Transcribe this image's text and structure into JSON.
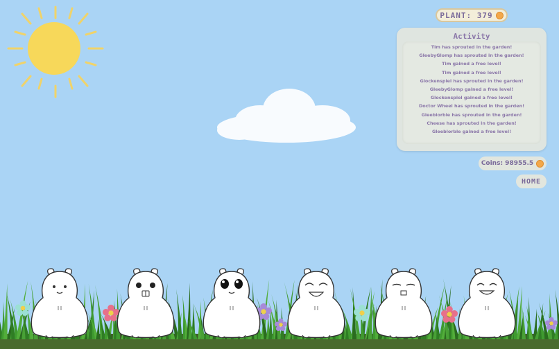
{
  "plant": {
    "label": "PLANT: 379"
  },
  "activity": {
    "title": "Activity",
    "entries": [
      "Tim has sprouted in the garden!",
      "GleebyGlomp has sprouted in the garden!",
      "Tim gained a free level!",
      "Tim gained a free level!",
      "Glockenspiel has sprouted in the garden!",
      "GleebyGlomp gained a free level!",
      "Glockenspiel gained a free level!",
      "Doctor Wheel has sprouted in the garden!",
      "Gleeblorble has sprouted in the garden!",
      "Cheese has sprouted in the garden!",
      "Gleeblorble gained a free level!"
    ]
  },
  "coins": {
    "label": "Coins: 98955.5"
  },
  "home": {
    "label": "HOME"
  },
  "hamsters": [
    {
      "face": "neutral"
    },
    {
      "face": "teeth"
    },
    {
      "face": "big-eyes"
    },
    {
      "face": "laughing"
    },
    {
      "face": "smug"
    },
    {
      "face": "happy"
    }
  ],
  "colors": {
    "sky": "#aad4f5",
    "sun": "#f7d85a",
    "sun_rays": "#f0d36a",
    "panel": "#dfe5e0",
    "text_purple": "#8a76a8",
    "coin": "#f3a84a",
    "grass": "#3f8f2f",
    "soil": "#3d5a2a"
  }
}
